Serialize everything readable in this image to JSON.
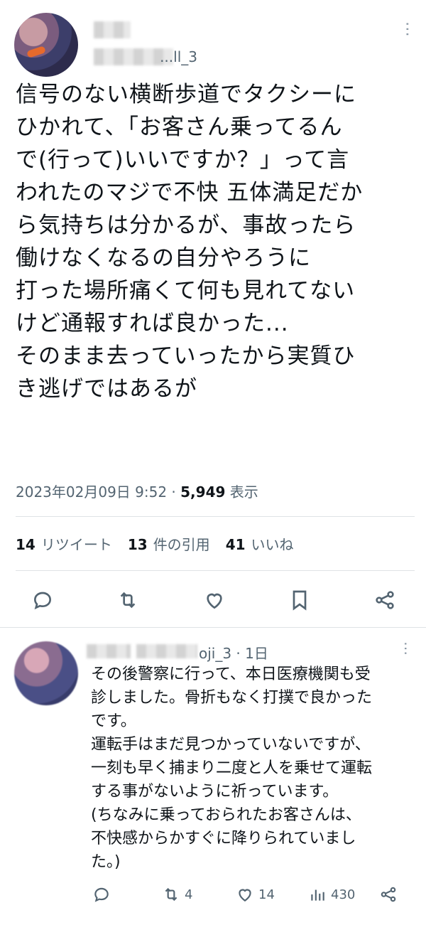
{
  "tweet": {
    "handle_suffix": "...ll_3",
    "text": "信号のない横断歩道でタクシーに\nひかれて、「お客さん乗ってるん\nで(行って)いいですか？」って言\nわれたのマジで不快 五体満足だか\nら気持ちは分かるが、事故ったら\n働けなくなるの自分やろうに\n打った場所痛くて何も見れてない\nけど通報すれば良かった...\nそのまま去っていったから実質ひ\nき逃げではあるが",
    "timestamp": "2023年02月09日 9:52 · ",
    "views_count": "5,949",
    "views_label": " 表示",
    "stats": {
      "retweets_count": "14",
      "retweets_label": "リツイート",
      "quotes_count": "13",
      "quotes_label": "件の引用",
      "likes_count": "41",
      "likes_label": "いいね"
    },
    "actions": [
      "reply-icon",
      "retweet-icon",
      "heart-icon",
      "bookmark-icon",
      "share-icon"
    ]
  },
  "reply": {
    "handle_time": "oji_3 · 1日",
    "text": "その後警察に行って、本日医療機関も受\n診しました。骨折もなく打撲で良かった\nです。\n運転手はまだ見つかっていないですが、\n一刻も早く捕まり二度と人を乗せて運転\nする事がないように祈っています。\n(ちなみに乗っておられたお客さんは、\n不快感からかすぐに降りられていまし\nた。)",
    "retweet_count": "4",
    "like_count": "14",
    "views_count": "430"
  },
  "colors": {
    "text": "#0f1419",
    "secondary": "#536471",
    "divider": "#dfe3e6"
  }
}
